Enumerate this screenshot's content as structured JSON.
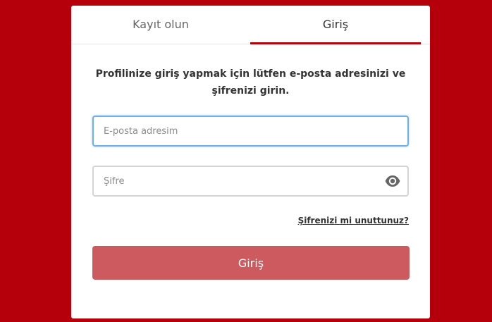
{
  "tabs": {
    "register_label": "Kayıt olun",
    "login_label": "Giriş"
  },
  "form": {
    "instruction": "Profilinize giriş yapmak için lütfen e-posta adresinizi ve şifrenizi girin.",
    "email_placeholder": "E-posta adresim",
    "email_value": "",
    "password_placeholder": "Şifre",
    "password_value": "",
    "forgot_label": "Şifrenizi mi unuttunuz?",
    "submit_label": "Giriş"
  },
  "icons": {
    "password_toggle": "eye-icon"
  },
  "colors": {
    "background": "#b5000b",
    "active_tab_underline": "#b5000b",
    "focus_border": "#6fb1e6",
    "submit_button": "#cd5a5f"
  }
}
